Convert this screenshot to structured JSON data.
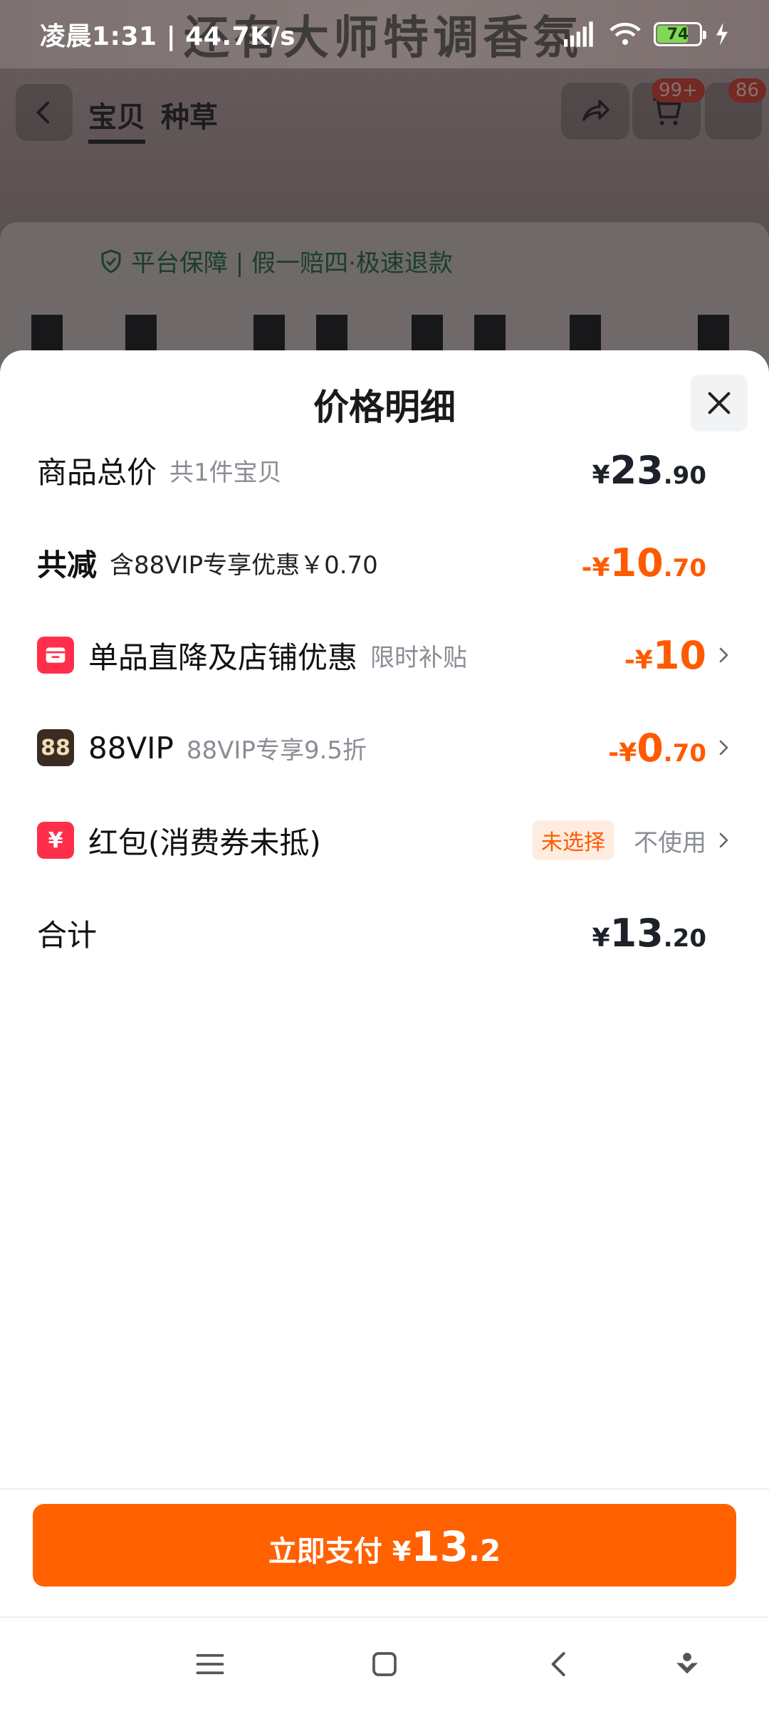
{
  "status_bar": {
    "time": "凌晨1:31 | 44.7K/s",
    "battery": "74"
  },
  "background": {
    "banner_text": "还有大师特调香氛",
    "tabs": [
      "宝贝",
      "种草"
    ],
    "cart_badge": "99+",
    "msg_badge": "86",
    "guarantee": "平台保障 | 假一赔四·极速退款"
  },
  "sheet": {
    "title": "价格明细",
    "rows": {
      "total": {
        "label": "商品总价",
        "sub": "共1件宝贝",
        "yen": "¥",
        "int": "23",
        "dec": ".90"
      },
      "discount": {
        "label": "共减",
        "sub": "含88VIP专享优惠￥0.70",
        "sign": "-¥",
        "int": "10",
        "dec": ".70"
      },
      "shop": {
        "label": "单品直降及店铺优惠",
        "sub": "限时补贴",
        "sign": "-¥",
        "int": "10"
      },
      "vip": {
        "icon_text": "88",
        "label": "88VIP",
        "sub": "88VIP专享9.5折",
        "sign": "-¥",
        "int": "0",
        "dec": ".70"
      },
      "redpacket": {
        "icon_text": "¥",
        "label": "红包(消费券未抵)",
        "tag": "未选择",
        "action": "不使用"
      },
      "sum": {
        "label": "合计",
        "yen": "¥",
        "int": "13",
        "dec": ".20"
      }
    }
  },
  "footer": {
    "pay_label": "立即支付",
    "pay_yen": "¥",
    "pay_int": "13",
    "pay_dec": ".2"
  },
  "colors": {
    "accent": "#ff6100",
    "discount": "#ff5a00",
    "red_icon": "#ff2f4b",
    "vip_icon": "#3a2c22"
  },
  "icons": [
    "back-icon",
    "share-icon",
    "cart-icon",
    "close-icon",
    "shop-icon",
    "vip-icon",
    "redpacket-icon",
    "chevron-right-icon",
    "menu-icon",
    "home-icon",
    "back-nav-icon",
    "assistant-icon"
  ]
}
